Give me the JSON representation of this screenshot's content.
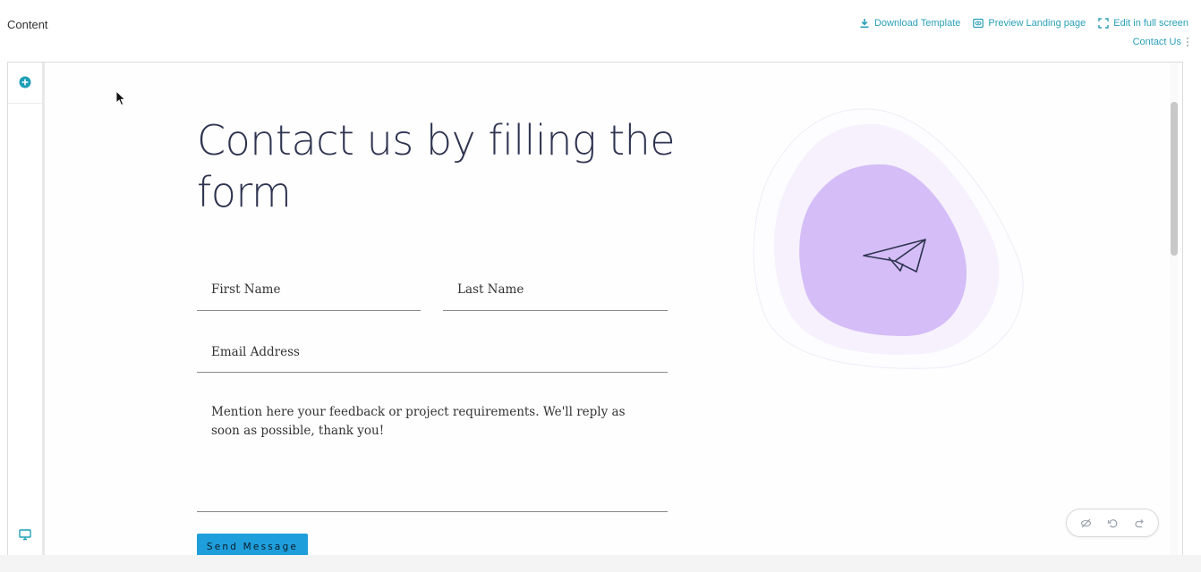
{
  "topbar": {
    "title": "Content",
    "actions": [
      {
        "label": "Download Template",
        "icon": "download-icon"
      },
      {
        "label": "Preview Landing page",
        "icon": "eye-icon"
      },
      {
        "label": "Edit in full screen",
        "icon": "fullscreen-icon"
      }
    ],
    "page_select": {
      "label": "Contact Us",
      "icon": "kebab-menu-icon"
    }
  },
  "rail": {
    "add_icon": "add-circle-icon",
    "device_icon": "desktop-icon"
  },
  "form_page": {
    "heading": "Contact us by filling the form",
    "fields": {
      "first_name": "First Name",
      "last_name": "Last Name",
      "email": "Email Address",
      "message": "Mention here your feedback or project requirements. We'll reply as soon as possible, thank you!"
    },
    "submit_label": "Send Message",
    "illustration_icon": "paper-plane-icon"
  },
  "history_controls": [
    "hide-icon",
    "undo-icon",
    "redo-icon"
  ],
  "colors": {
    "accent": "#2aa0b8",
    "button": "#1e9fdc",
    "blob_outer": "#f6f1fd",
    "blob_inner": "#d5bdf7",
    "heading": "#2e3450"
  }
}
